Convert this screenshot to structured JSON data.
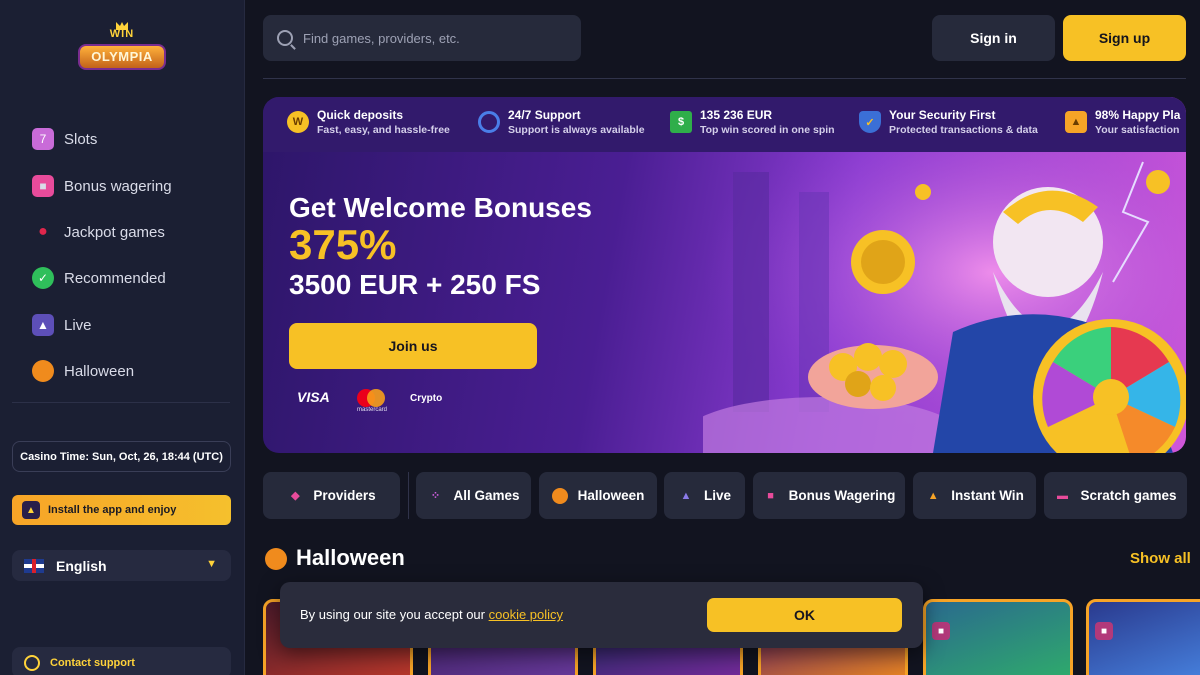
{
  "logo": {
    "top": "WIN",
    "main": "OLYMPIA"
  },
  "sidebar": {
    "items": [
      {
        "label": "Slots",
        "icon": "slot-machine-icon"
      },
      {
        "label": "Bonus wagering",
        "icon": "gift-icon"
      },
      {
        "label": "Jackpot games",
        "icon": "cherry-icon"
      },
      {
        "label": "Recommended",
        "icon": "check-badge-icon"
      },
      {
        "label": "Live",
        "icon": "dealer-icon"
      },
      {
        "label": "Halloween",
        "icon": "pumpkin-icon"
      }
    ],
    "casino_time": "Casino Time: Sun, Oct, 26, 18:44 (UTC)",
    "install_label": "Install the app and enjoy",
    "language": "English",
    "support_label": "Contact support"
  },
  "header": {
    "search_placeholder": "Find games, providers, etc.",
    "signin_label": "Sign in",
    "signup_label": "Sign up"
  },
  "banner": {
    "features": [
      {
        "title": "Quick deposits",
        "subtitle": "Fast, easy, and hassle-free",
        "icon": "coin-icon"
      },
      {
        "title": "24/7 Support",
        "subtitle": "Support is always available",
        "icon": "headset-icon"
      },
      {
        "title": "135 236 EUR",
        "subtitle": "Top win scored in one spin",
        "icon": "cash-icon"
      },
      {
        "title": "Your Security First",
        "subtitle": "Protected transactions & data",
        "icon": "shield-icon"
      },
      {
        "title": "98% Happy Pla",
        "subtitle": "Your satisfaction",
        "icon": "thumbs-up-icon"
      }
    ],
    "title": "Get Welcome Bonuses",
    "percent": "375%",
    "amount": "3500 EUR + 250 FS",
    "cta_label": "Join us",
    "payments": {
      "visa": "VISA",
      "mastercard_caption": "mastercard",
      "crypto": "Crypto"
    }
  },
  "categories": [
    {
      "label": "Providers",
      "icon": "providers-icon"
    },
    {
      "label": "All Games",
      "icon": "grid-icon"
    },
    {
      "label": "Halloween",
      "icon": "pumpkin-icon"
    },
    {
      "label": "Live",
      "icon": "dealer-icon"
    },
    {
      "label": "Bonus Wagering",
      "icon": "gift-icon"
    },
    {
      "label": "Instant Win",
      "icon": "rocket-icon"
    },
    {
      "label": "Scratch games",
      "icon": "ticket-icon"
    }
  ],
  "section": {
    "title": "Halloween",
    "show_all": "Show all"
  },
  "cookie": {
    "text": "By using our site you accept our ",
    "link": "cookie policy",
    "ok_label": "OK"
  },
  "colors": {
    "accent": "#f7c125",
    "sidebar_bg": "#1b1f33",
    "page_bg": "#121420"
  }
}
